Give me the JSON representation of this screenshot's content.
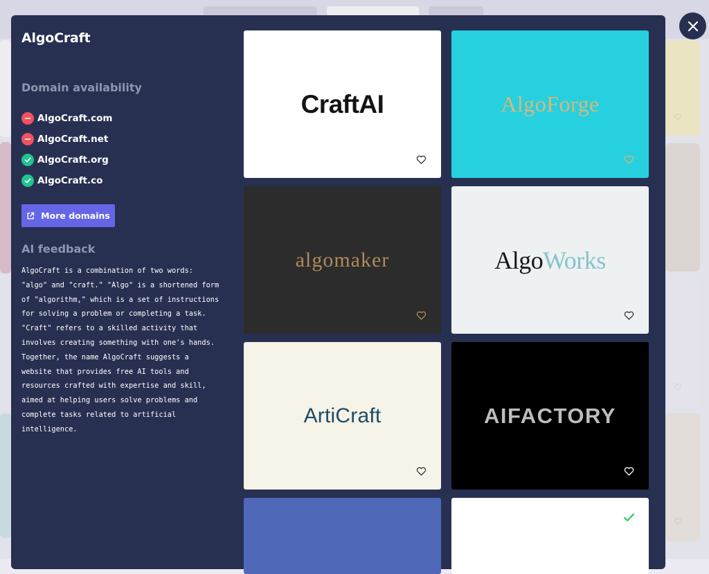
{
  "app": {
    "title": "AlgoCraft"
  },
  "domains": {
    "title": "Domain availability",
    "items": [
      {
        "name": "AlgoCraft.com",
        "status": "taken"
      },
      {
        "name": "AlgoCraft.net",
        "status": "taken"
      },
      {
        "name": "AlgoCraft.org",
        "status": "available"
      },
      {
        "name": "AlgoCraft.co",
        "status": "available"
      }
    ],
    "more_button": "More domains"
  },
  "feedback": {
    "title": "AI feedback",
    "text": "AlgoCraft is a combination of two words: \"algo\" and \"craft.\" \"Algo\" is a shortened form of \"algorithm,\" which is a set of instructions for solving a problem or completing a task. \"Craft\" refers to a skilled activity that involves creating something with one's hands. Together, the name AlgoCraft suggests a website that provides free AI tools and resources crafted with expertise and skill, aimed at helping users solve problems and complete tasks related to artificial intelligence."
  },
  "logos": [
    {
      "text": "CraftAI",
      "background": "#ffffff",
      "text_color": "#141414",
      "action_icon": "heart-icon"
    },
    {
      "text": "AlgoForge",
      "background": "#26d0de",
      "text_color": "#d8b87e",
      "action_icon": "heart-icon"
    },
    {
      "text": "algomaker",
      "background": "#2c2c2c",
      "text_color": "#b08a5a",
      "action_icon": "heart-icon"
    },
    {
      "text_a": "Algo",
      "text_b": "Works",
      "background": "#edf1f2",
      "text_color": "#161616",
      "accent_color": "#85c4cb",
      "action_icon": "heart-icon"
    },
    {
      "text": "ArtiCraft",
      "background": "#f6f3e8",
      "text_color": "#1d4b68",
      "action_icon": "heart-icon"
    },
    {
      "text": "AIFACTORY",
      "background": "#000000",
      "text_color": "#bdbdbd",
      "action_icon": "heart-icon"
    },
    {
      "text": "",
      "background": "#4f68b8"
    },
    {
      "text": "",
      "background": "#ffffff",
      "action_icon": "check-icon",
      "accent_color": "#2ecc71"
    }
  ],
  "colors": {
    "modal_bg": "#283052",
    "taken": "#ef5260",
    "available": "#22c48f",
    "button": "#6466e6"
  },
  "icons": {
    "close": "close-icon",
    "external": "external-link-icon",
    "taken": "minus-icon",
    "available": "check-icon"
  }
}
